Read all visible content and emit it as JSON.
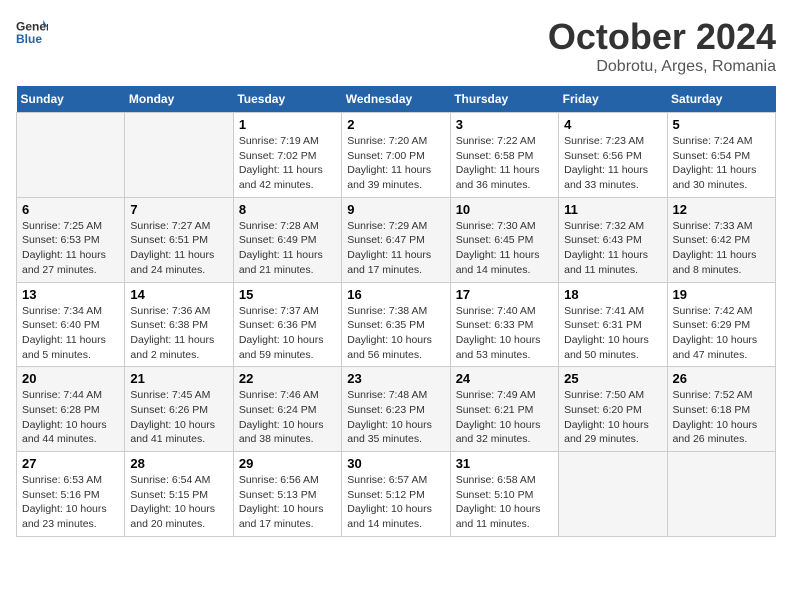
{
  "header": {
    "logo_general": "General",
    "logo_blue": "Blue",
    "month_title": "October 2024",
    "location": "Dobrotu, Arges, Romania"
  },
  "days_of_week": [
    "Sunday",
    "Monday",
    "Tuesday",
    "Wednesday",
    "Thursday",
    "Friday",
    "Saturday"
  ],
  "weeks": [
    [
      {
        "day": "",
        "info": ""
      },
      {
        "day": "",
        "info": ""
      },
      {
        "day": "1",
        "info": "Sunrise: 7:19 AM\nSunset: 7:02 PM\nDaylight: 11 hours and 42 minutes."
      },
      {
        "day": "2",
        "info": "Sunrise: 7:20 AM\nSunset: 7:00 PM\nDaylight: 11 hours and 39 minutes."
      },
      {
        "day": "3",
        "info": "Sunrise: 7:22 AM\nSunset: 6:58 PM\nDaylight: 11 hours and 36 minutes."
      },
      {
        "day": "4",
        "info": "Sunrise: 7:23 AM\nSunset: 6:56 PM\nDaylight: 11 hours and 33 minutes."
      },
      {
        "day": "5",
        "info": "Sunrise: 7:24 AM\nSunset: 6:54 PM\nDaylight: 11 hours and 30 minutes."
      }
    ],
    [
      {
        "day": "6",
        "info": "Sunrise: 7:25 AM\nSunset: 6:53 PM\nDaylight: 11 hours and 27 minutes."
      },
      {
        "day": "7",
        "info": "Sunrise: 7:27 AM\nSunset: 6:51 PM\nDaylight: 11 hours and 24 minutes."
      },
      {
        "day": "8",
        "info": "Sunrise: 7:28 AM\nSunset: 6:49 PM\nDaylight: 11 hours and 21 minutes."
      },
      {
        "day": "9",
        "info": "Sunrise: 7:29 AM\nSunset: 6:47 PM\nDaylight: 11 hours and 17 minutes."
      },
      {
        "day": "10",
        "info": "Sunrise: 7:30 AM\nSunset: 6:45 PM\nDaylight: 11 hours and 14 minutes."
      },
      {
        "day": "11",
        "info": "Sunrise: 7:32 AM\nSunset: 6:43 PM\nDaylight: 11 hours and 11 minutes."
      },
      {
        "day": "12",
        "info": "Sunrise: 7:33 AM\nSunset: 6:42 PM\nDaylight: 11 hours and 8 minutes."
      }
    ],
    [
      {
        "day": "13",
        "info": "Sunrise: 7:34 AM\nSunset: 6:40 PM\nDaylight: 11 hours and 5 minutes."
      },
      {
        "day": "14",
        "info": "Sunrise: 7:36 AM\nSunset: 6:38 PM\nDaylight: 11 hours and 2 minutes."
      },
      {
        "day": "15",
        "info": "Sunrise: 7:37 AM\nSunset: 6:36 PM\nDaylight: 10 hours and 59 minutes."
      },
      {
        "day": "16",
        "info": "Sunrise: 7:38 AM\nSunset: 6:35 PM\nDaylight: 10 hours and 56 minutes."
      },
      {
        "day": "17",
        "info": "Sunrise: 7:40 AM\nSunset: 6:33 PM\nDaylight: 10 hours and 53 minutes."
      },
      {
        "day": "18",
        "info": "Sunrise: 7:41 AM\nSunset: 6:31 PM\nDaylight: 10 hours and 50 minutes."
      },
      {
        "day": "19",
        "info": "Sunrise: 7:42 AM\nSunset: 6:29 PM\nDaylight: 10 hours and 47 minutes."
      }
    ],
    [
      {
        "day": "20",
        "info": "Sunrise: 7:44 AM\nSunset: 6:28 PM\nDaylight: 10 hours and 44 minutes."
      },
      {
        "day": "21",
        "info": "Sunrise: 7:45 AM\nSunset: 6:26 PM\nDaylight: 10 hours and 41 minutes."
      },
      {
        "day": "22",
        "info": "Sunrise: 7:46 AM\nSunset: 6:24 PM\nDaylight: 10 hours and 38 minutes."
      },
      {
        "day": "23",
        "info": "Sunrise: 7:48 AM\nSunset: 6:23 PM\nDaylight: 10 hours and 35 minutes."
      },
      {
        "day": "24",
        "info": "Sunrise: 7:49 AM\nSunset: 6:21 PM\nDaylight: 10 hours and 32 minutes."
      },
      {
        "day": "25",
        "info": "Sunrise: 7:50 AM\nSunset: 6:20 PM\nDaylight: 10 hours and 29 minutes."
      },
      {
        "day": "26",
        "info": "Sunrise: 7:52 AM\nSunset: 6:18 PM\nDaylight: 10 hours and 26 minutes."
      }
    ],
    [
      {
        "day": "27",
        "info": "Sunrise: 6:53 AM\nSunset: 5:16 PM\nDaylight: 10 hours and 23 minutes."
      },
      {
        "day": "28",
        "info": "Sunrise: 6:54 AM\nSunset: 5:15 PM\nDaylight: 10 hours and 20 minutes."
      },
      {
        "day": "29",
        "info": "Sunrise: 6:56 AM\nSunset: 5:13 PM\nDaylight: 10 hours and 17 minutes."
      },
      {
        "day": "30",
        "info": "Sunrise: 6:57 AM\nSunset: 5:12 PM\nDaylight: 10 hours and 14 minutes."
      },
      {
        "day": "31",
        "info": "Sunrise: 6:58 AM\nSunset: 5:10 PM\nDaylight: 10 hours and 11 minutes."
      },
      {
        "day": "",
        "info": ""
      },
      {
        "day": "",
        "info": ""
      }
    ]
  ]
}
